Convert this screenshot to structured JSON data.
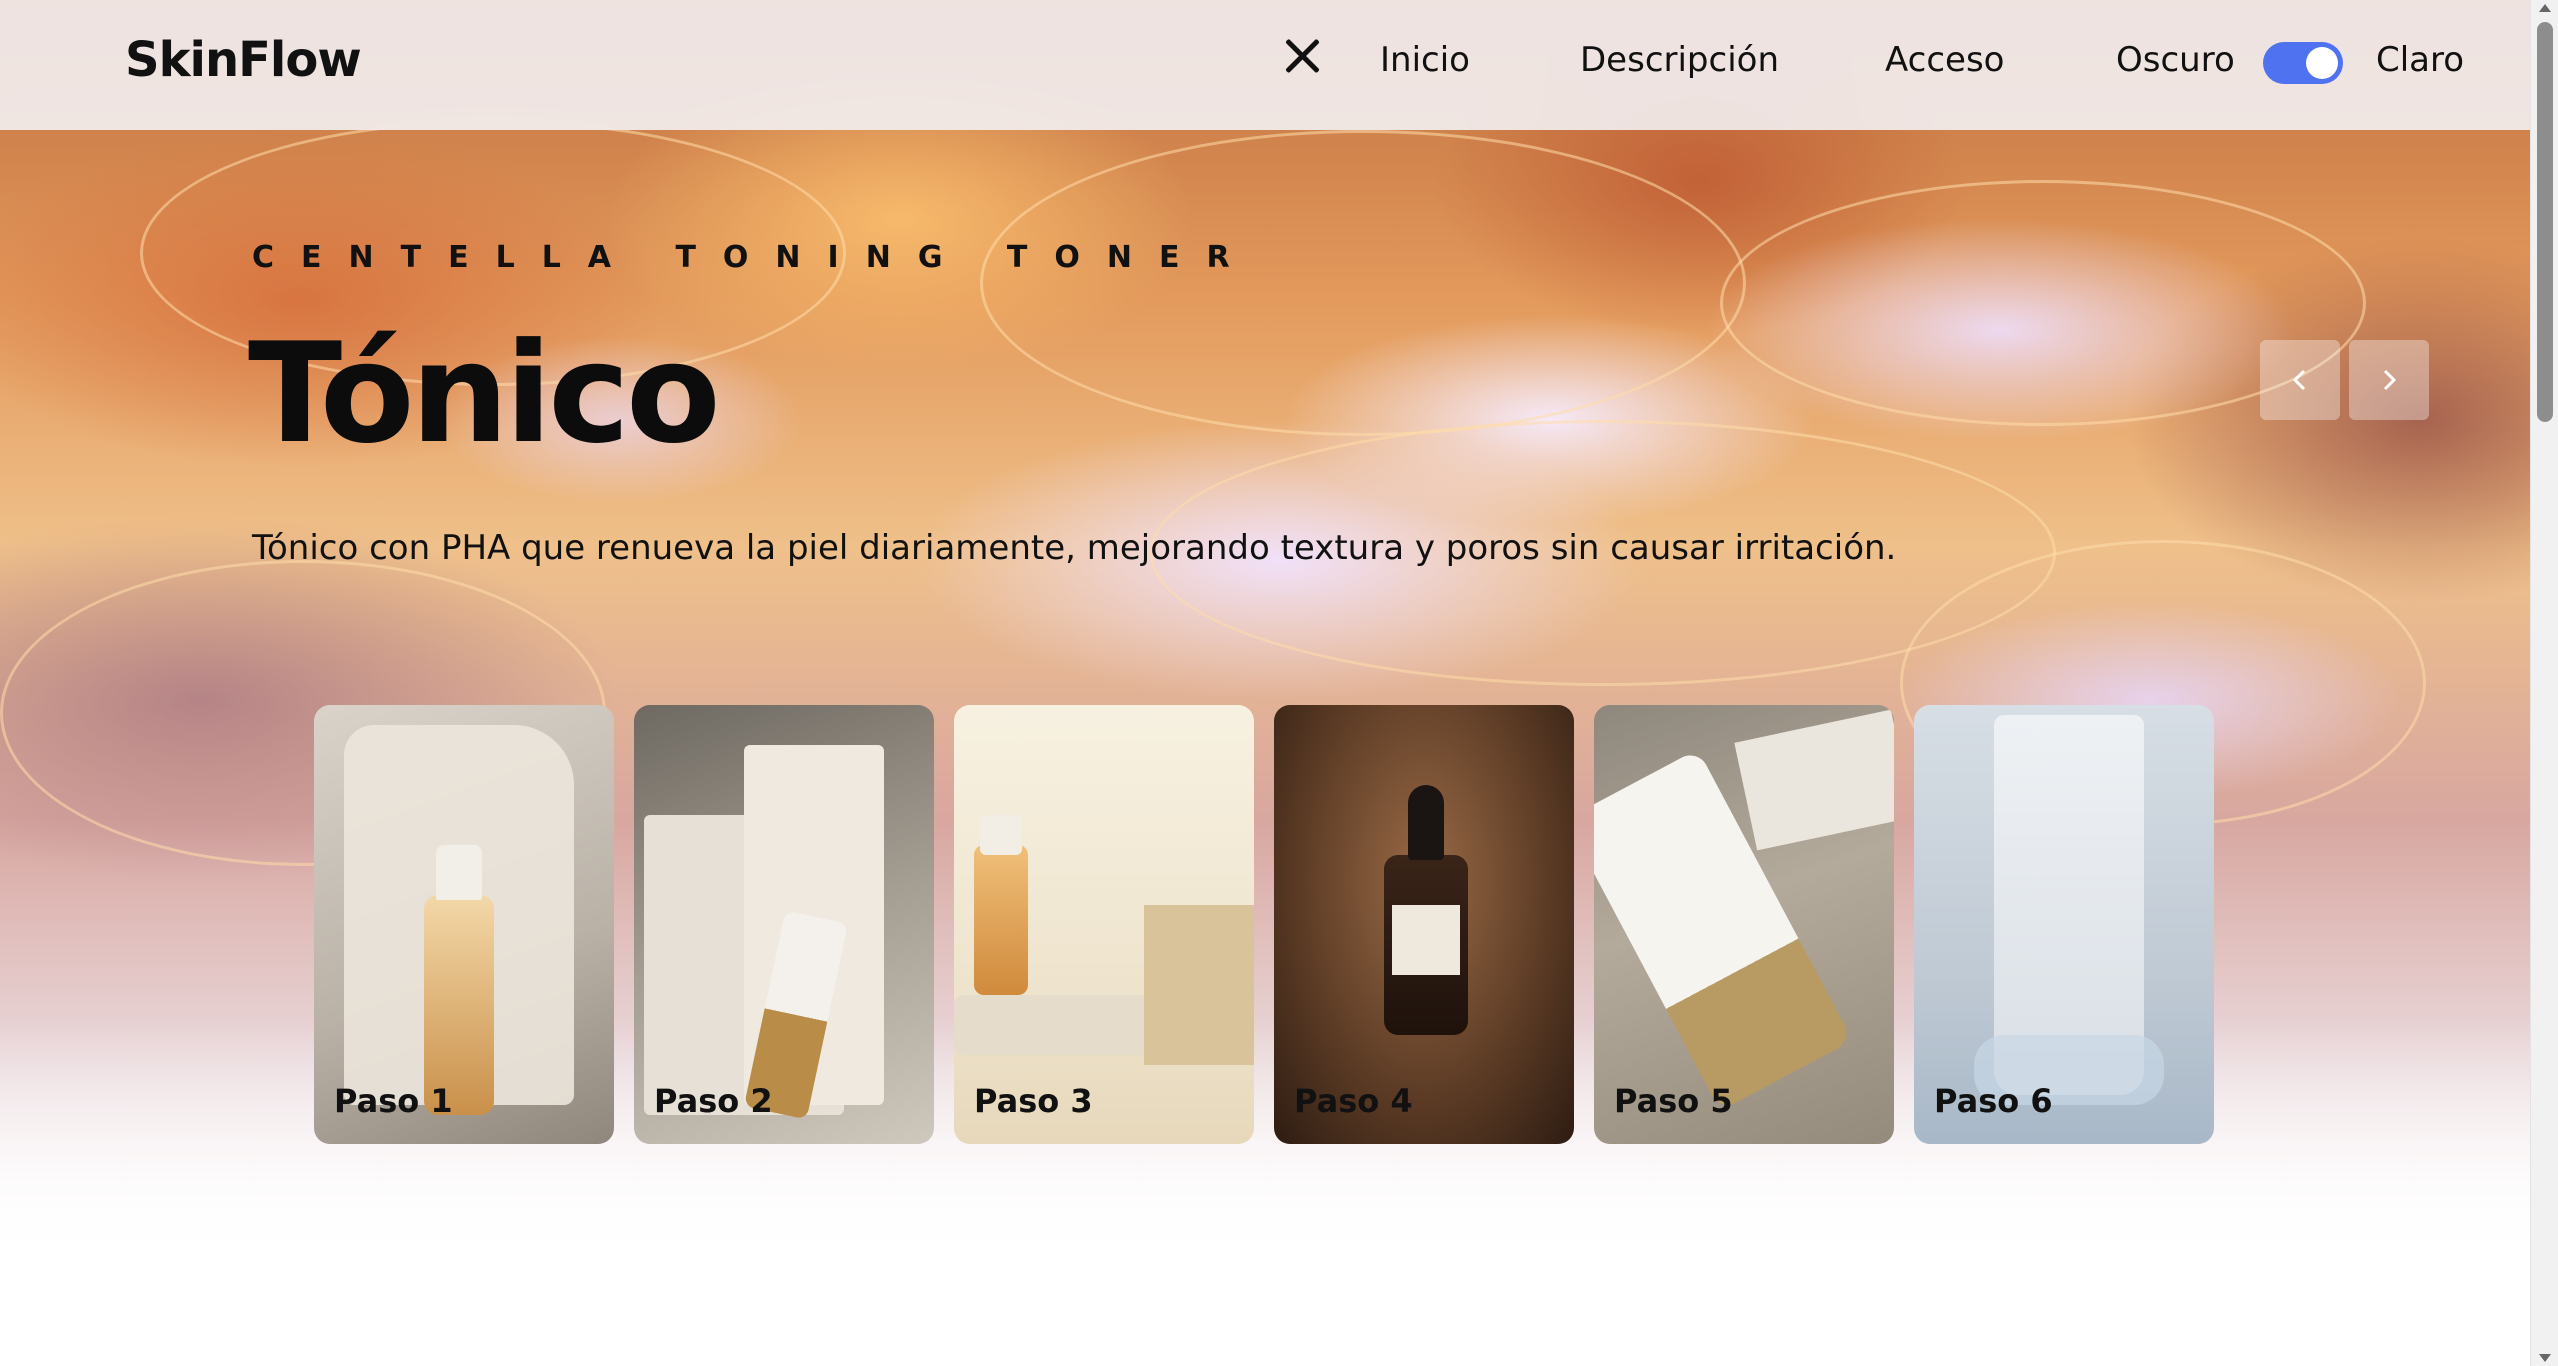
{
  "brand": {
    "name": "SkinFlow"
  },
  "nav": {
    "close_icon": "close-icon",
    "links": [
      "Inicio",
      "Descripción",
      "Acceso"
    ],
    "theme_toggle": {
      "dark_label": "Oscuro",
      "light_label": "Claro",
      "state": "on"
    }
  },
  "hero": {
    "eyebrow": "CENTELLA TONING TONER",
    "title": "Tónico",
    "description": "Tónico con PHA que renueva la piel diariamente, mejorando textura y poros sin causar irritación.",
    "prev_icon": "chevron-left-icon",
    "next_icon": "chevron-right-icon"
  },
  "steps": [
    {
      "label": "Paso 1"
    },
    {
      "label": "Paso 2"
    },
    {
      "label": "Paso 3"
    },
    {
      "label": "Paso 4"
    },
    {
      "label": "Paso 5"
    },
    {
      "label": "Paso 6"
    }
  ],
  "colors": {
    "accent": "#4f73f0",
    "text": "#111111"
  }
}
